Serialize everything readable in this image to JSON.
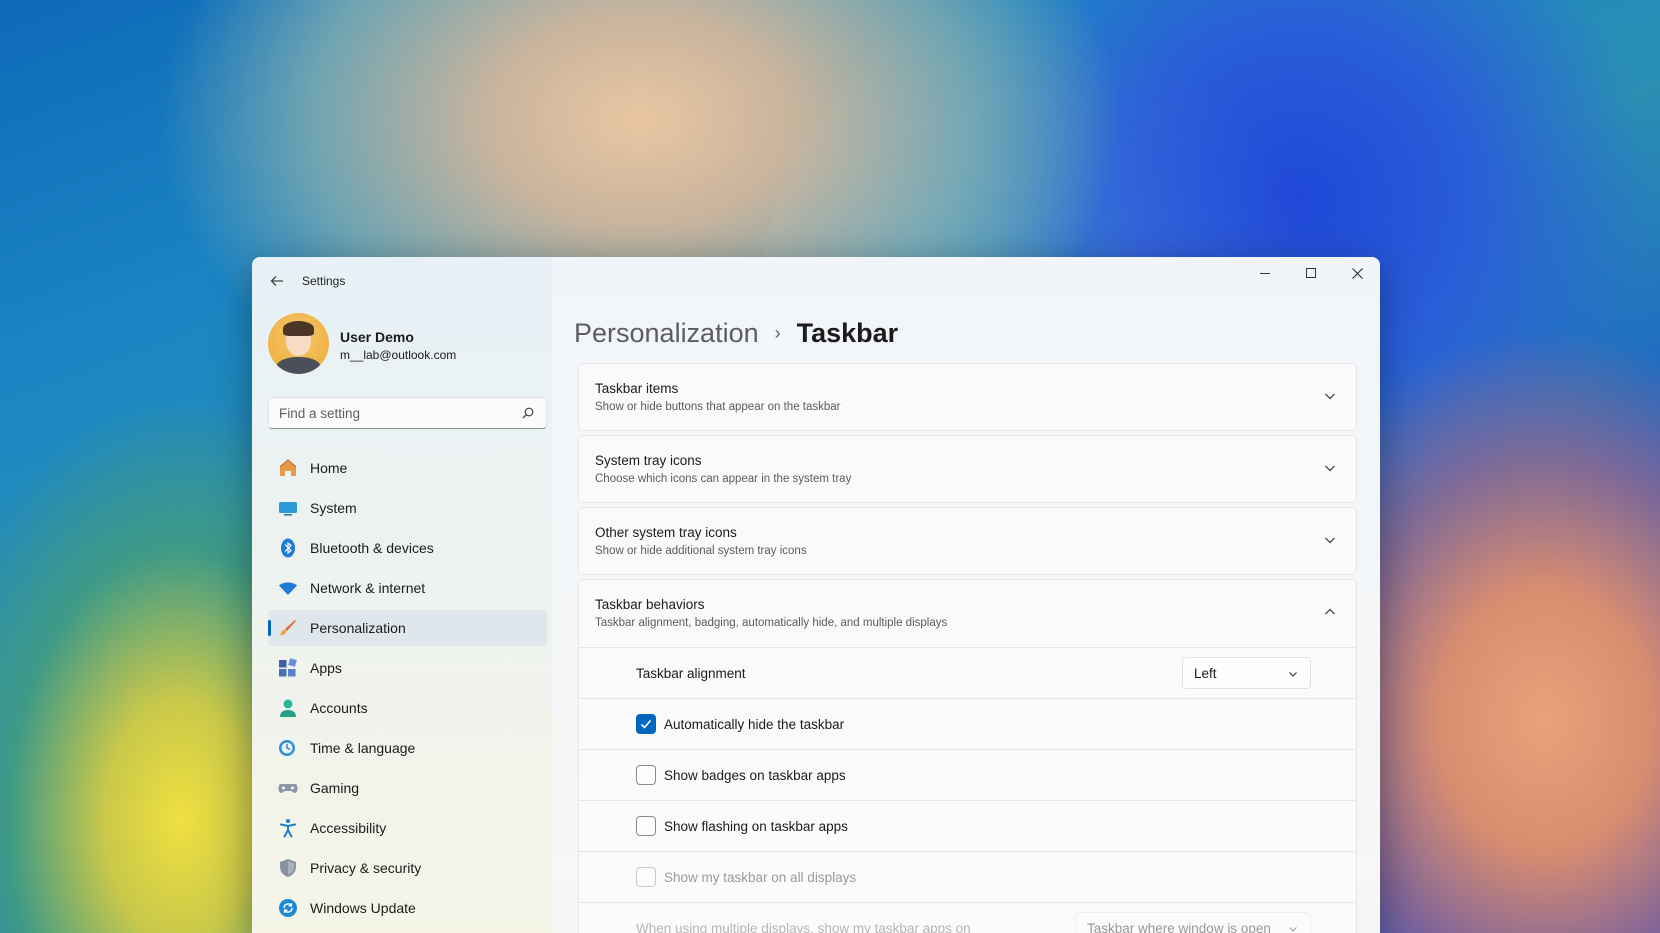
{
  "window": {
    "app_title": "Settings"
  },
  "profile": {
    "name": "User Demo",
    "email": "m__lab@outlook.com"
  },
  "search": {
    "placeholder": "Find a setting"
  },
  "nav": {
    "items": [
      {
        "label": "Home",
        "icon": "home-icon"
      },
      {
        "label": "System",
        "icon": "system-icon"
      },
      {
        "label": "Bluetooth & devices",
        "icon": "bluetooth-icon"
      },
      {
        "label": "Network & internet",
        "icon": "wifi-icon"
      },
      {
        "label": "Personalization",
        "icon": "brush-icon",
        "active": true
      },
      {
        "label": "Apps",
        "icon": "apps-icon"
      },
      {
        "label": "Accounts",
        "icon": "accounts-icon"
      },
      {
        "label": "Time & language",
        "icon": "time-language-icon"
      },
      {
        "label": "Gaming",
        "icon": "gamepad-icon"
      },
      {
        "label": "Accessibility",
        "icon": "accessibility-icon"
      },
      {
        "label": "Privacy & security",
        "icon": "shield-icon"
      },
      {
        "label": "Windows Update",
        "icon": "update-icon"
      }
    ]
  },
  "breadcrumb": {
    "parent": "Personalization",
    "separator": "›",
    "current": "Taskbar"
  },
  "cards": [
    {
      "title": "Taskbar items",
      "desc": "Show or hide buttons that appear on the taskbar"
    },
    {
      "title": "System tray icons",
      "desc": "Choose which icons can appear in the system tray"
    },
    {
      "title": "Other system tray icons",
      "desc": "Show or hide additional system tray icons"
    }
  ],
  "behaviors": {
    "title": "Taskbar behaviors",
    "desc": "Taskbar alignment, badging, automatically hide, and multiple displays",
    "alignment_label": "Taskbar alignment",
    "alignment_value": "Left",
    "checkboxes": [
      {
        "label": "Automatically hide the taskbar",
        "checked": true,
        "disabled": false
      },
      {
        "label": "Show badges on taskbar apps",
        "checked": false,
        "disabled": false
      },
      {
        "label": "Show flashing on taskbar apps",
        "checked": false,
        "disabled": false
      },
      {
        "label": "Show my taskbar on all displays",
        "checked": false,
        "disabled": true
      }
    ],
    "multi_display_label": "When using multiple displays, show my taskbar apps on",
    "multi_display_value": "Taskbar where window is open"
  },
  "colors": {
    "accent": "#0067c0"
  }
}
